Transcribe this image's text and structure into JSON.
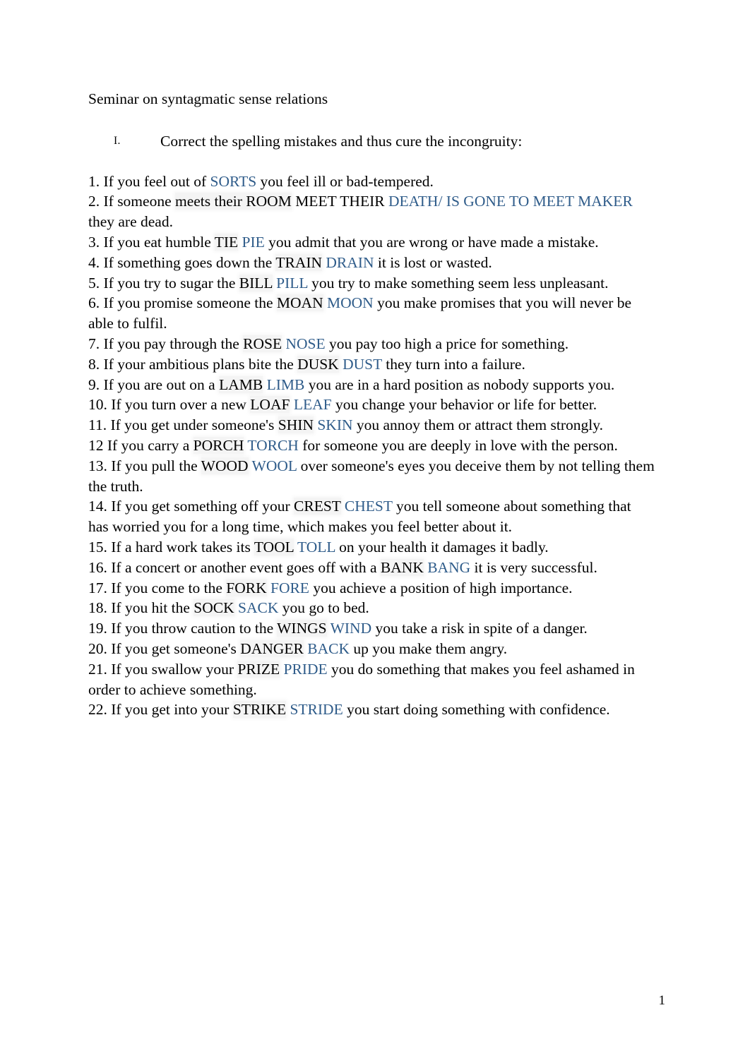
{
  "document": {
    "title": "Seminar on syntagmatic sense relations",
    "page_number": "1",
    "accent_color": "#2f5c8a",
    "text_color": "#000000",
    "background_color": "#ffffff"
  },
  "sections": [
    {
      "marker": "I.",
      "heading": "Correct the spelling mistakes and thus cure the incongruity:"
    }
  ],
  "exercises": [
    {
      "number": "1.",
      "lead": " If you feel out of ",
      "wrong": "",
      "mid": "",
      "right": "SORTS",
      "tail": "  you feel ill or bad-tempered."
    },
    {
      "number": "2.",
      "lead": " If someone ",
      "wrong": "meets their ROOM",
      "mid": "  MEET THEIR  ",
      "right": "DEATH/ IS GONE TO MEET MAKER",
      "tail": "   they are dead."
    },
    {
      "number": "3.",
      "lead": " If you eat humble ",
      "wrong": "TIE",
      "mid": "  ",
      "right": "PIE",
      "tail": "  you admit that you are wrong or have made a mistake."
    },
    {
      "number": "4.",
      "lead": " If something goes down the ",
      "wrong": "TRAIN",
      "mid": "  ",
      "right": "DRAIN",
      "tail": " it is lost or wasted."
    },
    {
      "number": "5.",
      "lead": " If you try to sugar the ",
      "wrong": "BILL",
      "mid": "  ",
      "right": "PILL",
      "tail": "  you try to make something seem less unpleasant."
    },
    {
      "number": "6.",
      "lead": " If you promise someone the ",
      "wrong": "MOAN",
      "mid": "  ",
      "right": "MOON",
      "tail": "  you make promises that you will never be able to fulfil."
    },
    {
      "number": "7.",
      "lead": " If you pay through the ",
      "wrong": "ROSE",
      "mid": "  ",
      "right": "NOSE",
      "tail": "  you pay too high a price for something."
    },
    {
      "number": "8.",
      "lead": " If your ambitious plans bite the ",
      "wrong": "DUSK",
      "mid": " ",
      "right": "DUST",
      "tail": " they turn into a failure."
    },
    {
      "number": "9.",
      "lead": " If you are out on a ",
      "wrong": "LAMB",
      "mid": "  ",
      "right": "LIMB",
      "tail": "  you are in a hard position as nobody supports you."
    },
    {
      "number": "10.",
      "lead": " If you turn over a new ",
      "wrong": "LOAF",
      "mid": "   ",
      "right": "LEAF",
      "tail": "  you change your behavior or life for better."
    },
    {
      "number": "11.",
      "lead": " If you get under someone's ",
      "wrong": "SHIN",
      "mid": "  ",
      "right": "SKIN",
      "tail": " you annoy them or attract them strongly."
    },
    {
      "number": "12",
      "lead": " If you carry a ",
      "wrong": "PORCH",
      "mid": "  ",
      "right": "TORCH",
      "tail": "  for someone  you are deeply in love with the person."
    },
    {
      "number": "13.",
      "lead": " If you pull the ",
      "wrong": "WOOD",
      "mid": "  ",
      "right": "WOOL",
      "tail": "  over someone's eyes  you deceive them by not telling them the truth."
    },
    {
      "number": "14.",
      "lead": " If you get something off your ",
      "wrong": "CREST",
      "mid": "   ",
      "right": "CHEST",
      "tail": "  you tell someone about something that has worried you for a long time, which makes you feel better about it."
    },
    {
      "number": "15.",
      "lead": " If a hard work takes its ",
      "wrong": "TOOL",
      "mid": "  ",
      "right": "TOLL",
      "tail": "  on your health it damages it badly."
    },
    {
      "number": "16.",
      "lead": " If a concert or another event goes off with a ",
      "wrong": "BANK",
      "mid": " ",
      "right": "BANG",
      "tail": " it is very successful."
    },
    {
      "number": "17.",
      "lead": " If you come to the ",
      "wrong": "FORK",
      "mid": "  ",
      "right": "FORE",
      "tail": "  you achieve a position of high importance."
    },
    {
      "number": "18.",
      "lead": " If you hit the ",
      "wrong": "SOCK",
      "mid": "  ",
      "right": "SACK",
      "tail": "  you go to bed."
    },
    {
      "number": "19.",
      "lead": " If you throw caution to the ",
      "wrong": "WINGS",
      "mid": "   ",
      "right": "WIND",
      "tail": " you take a risk in spite of a danger."
    },
    {
      "number": "20.",
      "lead": " If you get someone's ",
      "wrong": "DANGER",
      "mid": "  ",
      "right": "BACK",
      "tail": " up you make them angry."
    },
    {
      "number": "21.",
      "lead": " If you swallow your ",
      "wrong": "PRIZE",
      "mid": "  ",
      "right": "PRIDE",
      "tail": "  you do something that makes you feel ashamed in order to achieve something."
    },
    {
      "number": "22.",
      "lead": " If you get into your ",
      "wrong": "STRIKE",
      "mid": "   ",
      "right": "STRIDE",
      "tail": "  you start doing something with confidence."
    }
  ]
}
